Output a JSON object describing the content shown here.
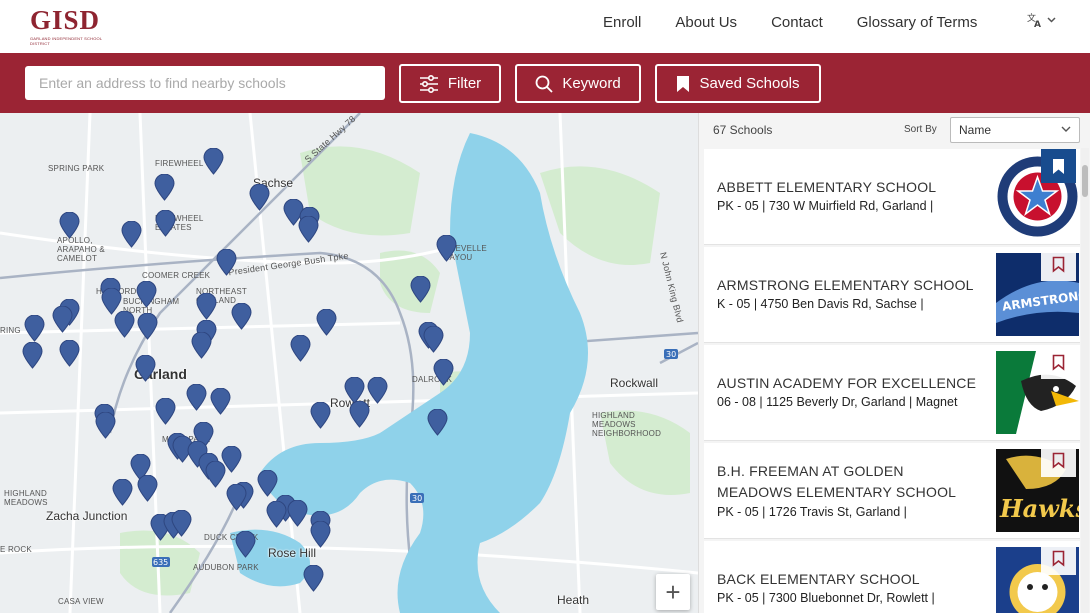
{
  "header": {
    "logo_text": "GISD",
    "logo_subtext": "GARLAND INDEPENDENT SCHOOL DISTRICT",
    "nav": [
      "Enroll",
      "About Us",
      "Contact",
      "Glossary of Terms"
    ],
    "language_icon": "translate-icon"
  },
  "toolbar": {
    "search_placeholder": "Enter an address to find nearby schools",
    "filter_label": "Filter",
    "keyword_label": "Keyword",
    "saved_label": "Saved Schools"
  },
  "map": {
    "labels": [
      "FIREWHEEL",
      "SPRING PARK",
      "FIREWHEEL ESTATES",
      "APOLLO, ARAPAHO & CAMELOT",
      "COOMER CREEK",
      "HOLFORD",
      "BUCKINGHAM NORTH",
      "NORTHEAST GARLAND",
      "DUCK CREEK",
      "AUDUBON PARK",
      "CASA VIEW",
      "HIGHLAND MEADOWS",
      "HIGHLAND MEADOWS NEIGHBORHOOD",
      "BREVELLE BAYOU",
      "DALROCK",
      "MARK PARK"
    ],
    "cities": [
      "Sachse",
      "Garland",
      "Rowlett",
      "Rockwall",
      "Zacha Junction",
      "Rose Hill",
      "Heath",
      "RING",
      "E ROCK"
    ],
    "roads": [
      "S State Hwy 78",
      "President George Bush Tpke",
      "N John King Blvd"
    ],
    "zoom_in": "+"
  },
  "results": {
    "count_label": "67 Schools",
    "sort_label": "Sort By",
    "sort_value": "Name",
    "schools": [
      {
        "name": "ABBETT ELEMENTARY SCHOOL",
        "info": "PK - 05 | 730 W Muirfield Rd, Garland |",
        "saved": true
      },
      {
        "name": "ARMSTRONG ELEMENTARY SCHOOL",
        "info": "K - 05 | 4750 Ben Davis Rd, Sachse |",
        "saved": false
      },
      {
        "name": "AUSTIN ACADEMY FOR EXCELLENCE",
        "info": "06 - 08 | 1125 Beverly Dr, Garland | Magnet",
        "saved": false
      },
      {
        "name": "B.H. FREEMAN at GOLDEN MEADOWS ELEMENTARY SCHOOL",
        "info": "PK - 05 | 1726 Travis St, Garland |",
        "saved": false
      },
      {
        "name": "BACK ELEMENTARY SCHOOL",
        "info": "PK - 05 | 7300 Bluebonnet Dr, Rowlett |",
        "saved": false
      }
    ],
    "thumb_texts": [
      "ABBETT ELEMENTARY · GARLAND · TEXAS",
      "ARMSTRONG",
      "",
      "Hawks",
      ""
    ]
  },
  "colors": {
    "brand": "#9b2434",
    "pin": "#3f5f9f",
    "lake": "#8fd2ea",
    "saved_bg": "#184c8e"
  }
}
